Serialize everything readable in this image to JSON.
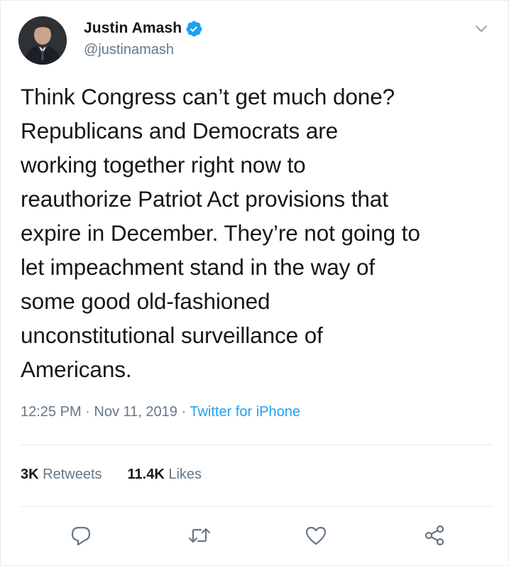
{
  "author": {
    "display_name": "Justin Amash",
    "handle": "@justinamash",
    "verified": true,
    "avatar_icon": "profile-photo"
  },
  "tweet": {
    "text": "Think Congress can’t get much done?\nRepublicans and Democrats are\nworking together right now to\nreauthorize Patriot Act provisions that\nexpire in December. They’re not going to\nlet impeachment stand in the way of\nsome good old-fashioned\nunconstitutional surveillance of\nAmericans.",
    "time": "12:25 PM",
    "separator": "·",
    "date": "Nov 11, 2019",
    "source": "Twitter for iPhone"
  },
  "stats": {
    "retweets_count": "3K",
    "retweets_label": "Retweets",
    "likes_count": "11.4K",
    "likes_label": "Likes"
  },
  "actions": [
    "reply-icon",
    "retweet-icon",
    "like-icon",
    "share-icon"
  ],
  "colors": {
    "accent": "#1da1f2",
    "text_primary": "#14171a",
    "text_secondary": "#657786",
    "divider": "#e6ecf0"
  }
}
